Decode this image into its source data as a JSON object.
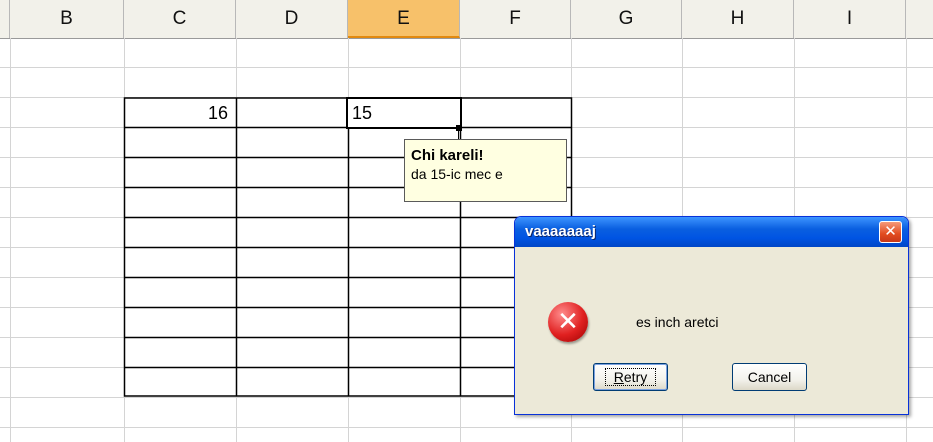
{
  "columns": [
    "B",
    "C",
    "D",
    "E",
    "F",
    "G",
    "H",
    "I"
  ],
  "selected_column": "E",
  "cells": {
    "c_value": "16",
    "e_value": "15"
  },
  "comment": {
    "author": "Chi kareli!",
    "text": "da 15-ic mec e"
  },
  "dialog": {
    "title": "vaaaaaaaj",
    "close_symbol": "✕",
    "icon": "error-icon",
    "message": "es inch aretci",
    "retry_label_first": "R",
    "retry_label_rest": "etry",
    "cancel_label": "Cancel"
  }
}
